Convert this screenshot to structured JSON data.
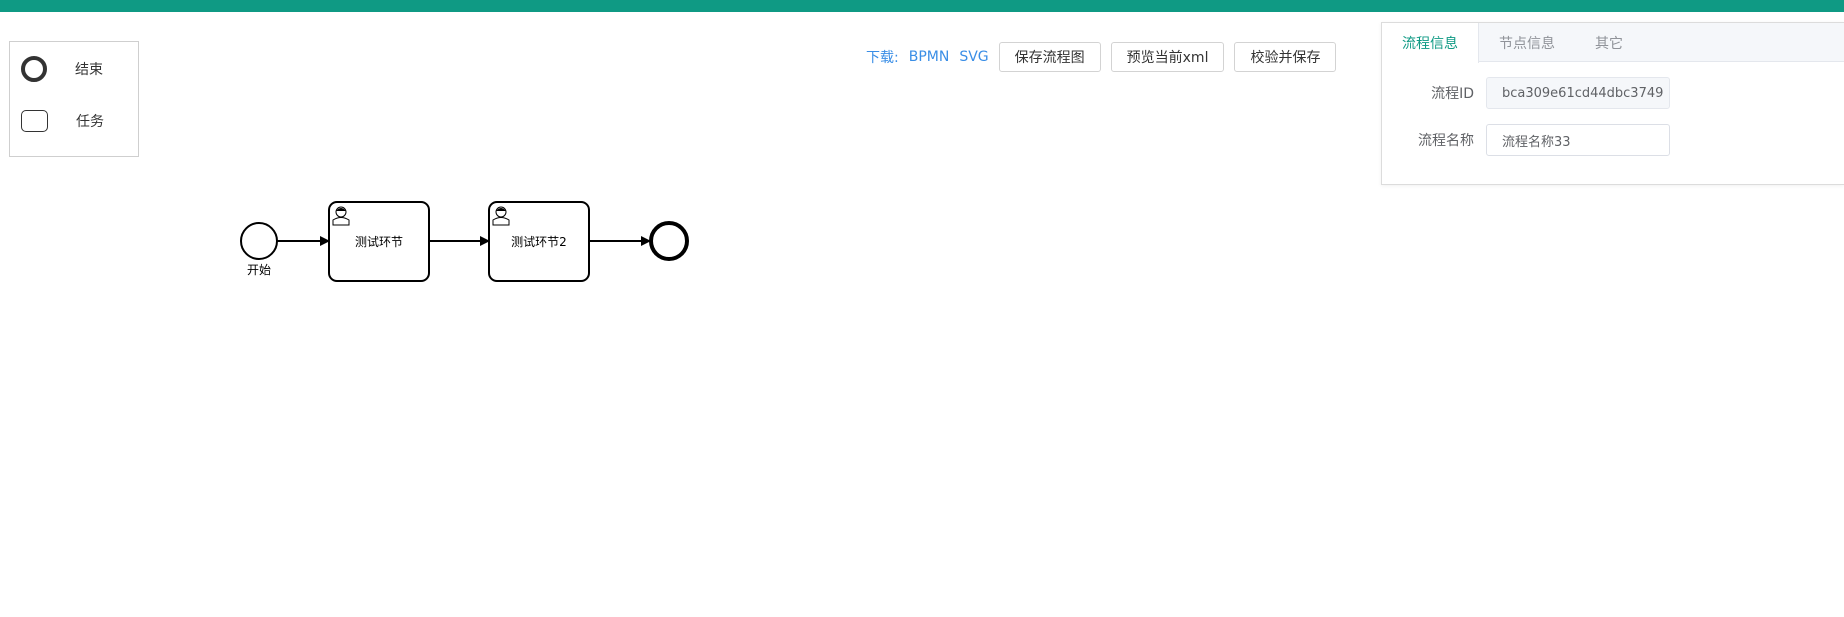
{
  "palette": {
    "end_label": "结束",
    "task_label": "任务"
  },
  "toolbar": {
    "download_label": "下载:",
    "bpmn_link": "BPMN",
    "svg_link": "SVG",
    "save_button": "保存流程图",
    "preview_button": "预览当前xml",
    "validate_button": "校验并保存"
  },
  "diagram": {
    "start_label": "开始",
    "task1_label": "测试环节",
    "task2_label": "测试环节2"
  },
  "panel": {
    "tabs": [
      {
        "label": "流程信息",
        "active": true
      },
      {
        "label": "节点信息",
        "active": false
      },
      {
        "label": "其它",
        "active": false
      }
    ],
    "process_id_label": "流程ID",
    "process_id_value": "bca309e61cd44dbc3749",
    "process_name_label": "流程名称",
    "process_name_value": "流程名称33"
  },
  "colors": {
    "accent": "#0f9a84",
    "link": "#3a8ee6"
  }
}
